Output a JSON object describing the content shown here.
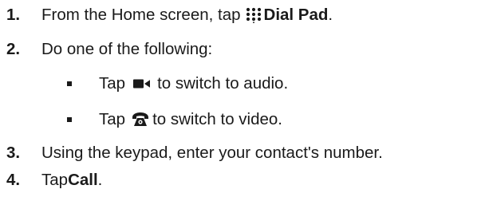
{
  "steps": [
    {
      "number": "1.",
      "text_before": "From the Home screen, tap ",
      "icon": "dial-pad-icon",
      "bold_text": "Dial Pad",
      "text_after": "."
    },
    {
      "number": "2.",
      "text": "Do one of the following:"
    },
    {
      "number": "3.",
      "text": "Using the keypad, enter your contact's number."
    },
    {
      "number": "4.",
      "text_before": "Tap ",
      "bold_text": "Call",
      "text_after": "."
    }
  ],
  "sub_steps": [
    {
      "text_before": "Tap",
      "icon": "video-camera-icon",
      "text_after": "to switch to audio."
    },
    {
      "text_before": "Tap",
      "icon": "phone-handset-icon",
      "text_after": "to switch to video."
    }
  ],
  "colors": {
    "text": "#1a1a1a",
    "background": "#ffffff"
  }
}
